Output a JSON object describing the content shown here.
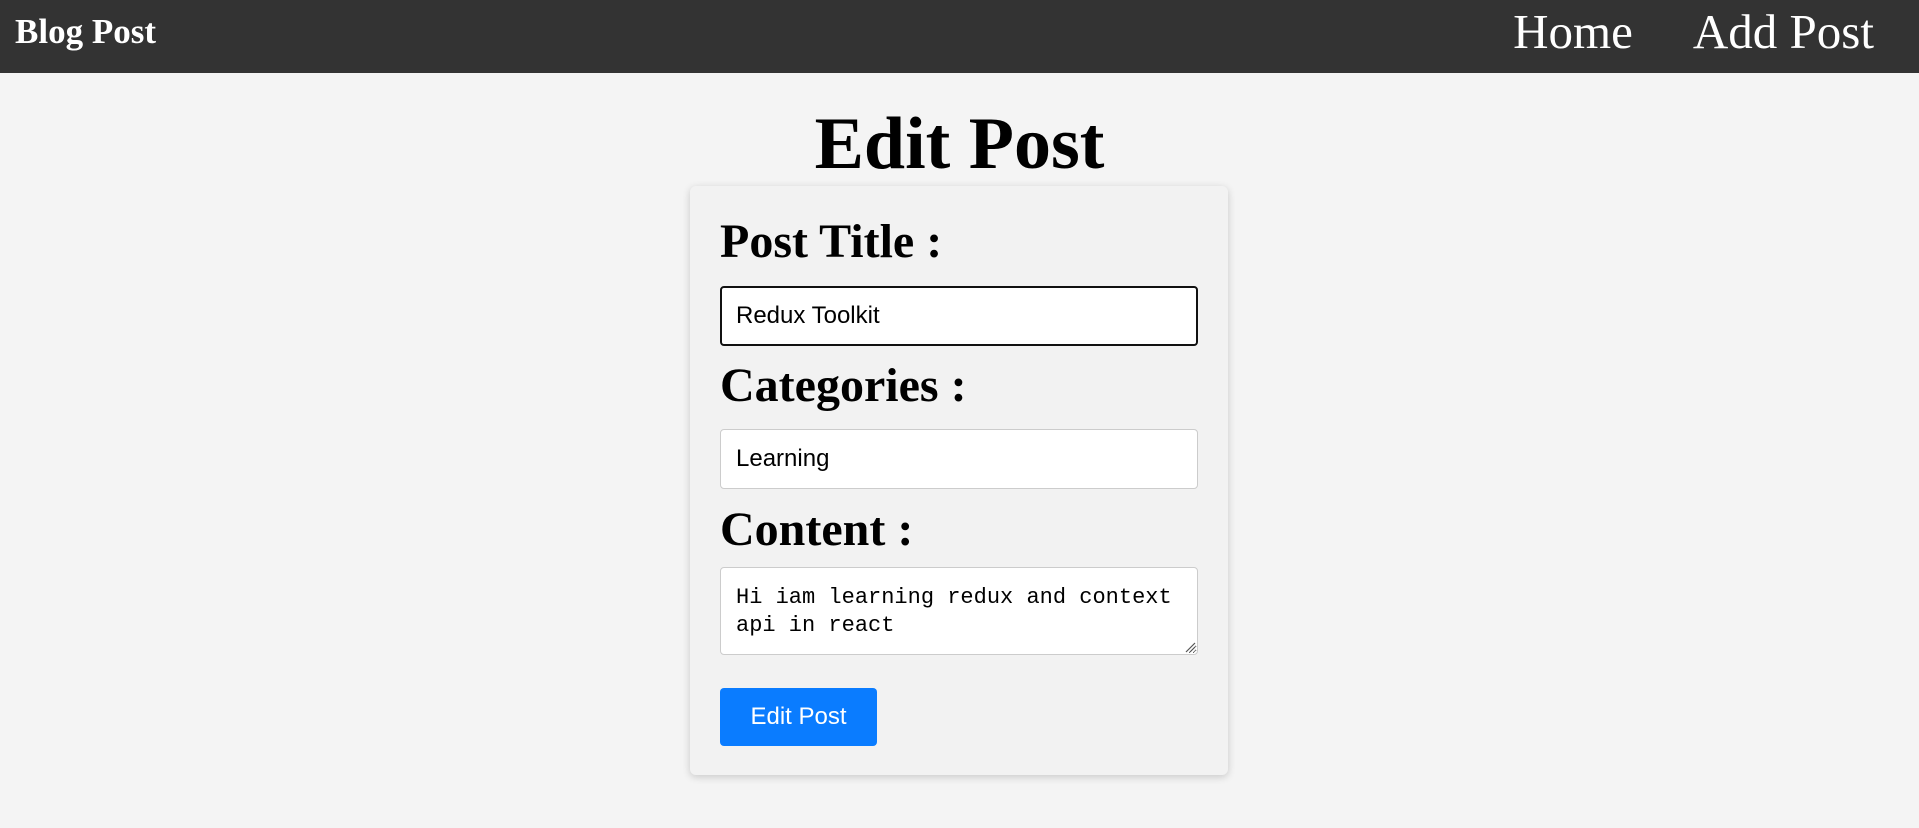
{
  "navbar": {
    "brand": "Blog Post",
    "links": [
      {
        "label": "Home"
      },
      {
        "label": "Add Post"
      }
    ]
  },
  "page": {
    "title": "Edit Post"
  },
  "form": {
    "title_label": "Post Title :",
    "title_value": "Redux Toolkit",
    "categories_label": "Categories :",
    "categories_value": "Learning",
    "content_label": "Content :",
    "content_value": "Hi iam learning redux and context api in react",
    "submit_label": "Edit Post"
  },
  "colors": {
    "navbar_bg": "#333333",
    "page_bg": "#f4f4f4",
    "button_bg": "#0a7cff"
  }
}
